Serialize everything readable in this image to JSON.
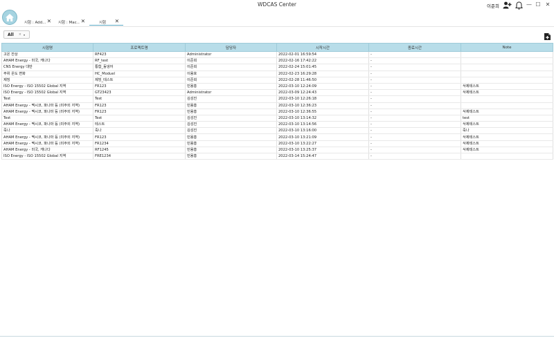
{
  "window": {
    "title": "WDCAS Center",
    "user_name": "이준희",
    "minimize": "—",
    "maximize": "☐",
    "close": "✕"
  },
  "tabs": [
    {
      "label": "시험 : Add...",
      "close": "✕"
    },
    {
      "label": "시험 : Mac...",
      "close": "✕"
    },
    {
      "label": "시험",
      "close": "✕"
    }
  ],
  "filter": {
    "value": "All",
    "clear": "×",
    "arrow": "▾"
  },
  "table": {
    "columns": [
      "시험명",
      "프로젝트명",
      "담당자",
      "시작시간",
      "종료시간",
      "Note"
    ],
    "rows": [
      [
        "고온 잔상",
        "RF423",
        "Administrator",
        "2022-02-01 16:59:54",
        "-",
        ""
      ],
      [
        "AHAM Energy - 미국, 캐나다",
        "RF_test",
        "이준희",
        "2022-02-16 17:42:22",
        "-",
        ""
      ],
      [
        "CNS Energy  대만",
        "통합_동냉어",
        "이준희",
        "2022-02-24 15:01:45",
        "-",
        ""
      ],
      [
        "주위 온도 변화",
        "HC_Moduel",
        "이용호",
        "2022-02-23 16:29:28",
        "-",
        ""
      ],
      [
        "제빙",
        "제빙_테스트",
        "이준희",
        "2022-02-28 11:46:50",
        "-",
        ""
      ],
      [
        "ISO Energy - ISO 15502  Global 지역",
        "FR123",
        "민용홍",
        "2022-03-10 12:24:09",
        "-",
        "삭제테스트"
      ],
      [
        "ISO Energy - ISO 15502  Global 지역",
        "GT23423",
        "Administrator",
        "2022-03-09 12:24:43",
        "-",
        "삭제테스트"
      ],
      [
        "Test",
        "Test",
        "김성진",
        "2022-03-10 12:26:18",
        "-",
        ""
      ],
      [
        "AHAM Energy - 멕시코, 파나마 등 (미주외 지역)",
        "FR123",
        "민용홍",
        "2022-03-10 12:36:23",
        "-",
        ""
      ],
      [
        "AHAM Energy - 멕시코, 파나마 등 (미주외 지역)",
        "FR123",
        "민용홍",
        "2022-03-10 12:36:55",
        "-",
        "삭제테스트"
      ],
      [
        "Test",
        "Test",
        "김성진",
        "2022-03-10 13:14:32",
        "-",
        "test"
      ],
      [
        "AHAM Energy - 멕시코, 파나마 등 (미주외 지역)",
        "테스트",
        "김성진",
        "2022-03-10 13:14:56",
        "-",
        "삭제테스트"
      ],
      [
        "죽나",
        "죽나",
        "김성진",
        "2022-03-10 13:16:00",
        "-",
        "죽나"
      ],
      [
        "AHAM Energy - 멕시코, 파나마 등 (미주외 지역)",
        "FR123",
        "민용홍",
        "2022-03-10 13:21:09",
        "-",
        "삭제테스트"
      ],
      [
        "AHAM Energy - 멕시코, 파나마 등 (미주외 지역)",
        "FR1234",
        "민용홍",
        "2022-03-10 13:22:27",
        "-",
        "삭제테스트"
      ],
      [
        "AHAM Energy - 미국, 캐나다",
        "RF1245",
        "민용홍",
        "2022-03-10 13:25:37",
        "-",
        "삭제테스트"
      ],
      [
        "ISO Energy - ISO 15502  Global 지역",
        "FRE1234",
        "민용홍",
        "2022-03-14 15:24:47",
        "-",
        ""
      ]
    ]
  },
  "icons": {
    "home": "home-icon",
    "add_user": "add-user-icon",
    "bell": "bell-icon",
    "export": "export-file-icon"
  },
  "colors": {
    "accent": "#5aa8c4",
    "header_bg": "#b8dde9",
    "home_bg": "#a6d4e1"
  }
}
